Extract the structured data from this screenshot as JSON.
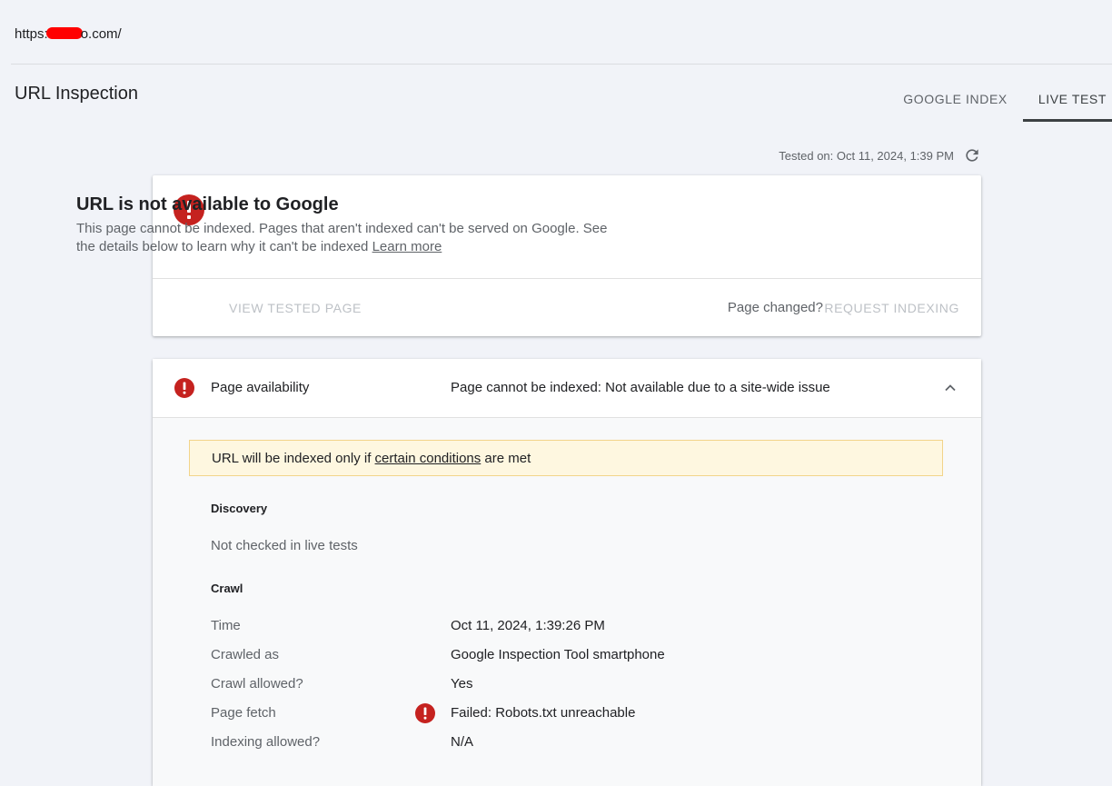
{
  "header": {
    "url_prefix": "https:",
    "url_suffix": "o.com/",
    "page_title": "URL Inspection",
    "tabs": [
      {
        "label": "GOOGLE INDEX",
        "active": false
      },
      {
        "label": "LIVE TEST",
        "active": true
      }
    ]
  },
  "test_info": {
    "tested_on": "Tested on: Oct 11, 2024, 1:39 PM"
  },
  "status_card": {
    "title": "URL is not available to Google",
    "description": "This page cannot be indexed. Pages that aren't indexed can't be served on Google. See the details below to learn why it can't be indexed",
    "learn_more": "Learn more",
    "view_tested_page": "VIEW TESTED PAGE",
    "page_changed": "Page changed?",
    "request_indexing": "REQUEST INDEXING"
  },
  "availability": {
    "label": "Page availability",
    "status": "Page cannot be indexed: Not available due to a site-wide issue",
    "notice_before": "URL will be indexed only if ",
    "notice_link": "certain conditions",
    "notice_after": " are met",
    "discovery": {
      "heading": "Discovery",
      "text": "Not checked in live tests"
    },
    "crawl": {
      "heading": "Crawl",
      "rows": [
        {
          "key": "Time",
          "value": "Oct 11, 2024, 1:39:26 PM",
          "error": false
        },
        {
          "key": "Crawled as",
          "value": "Google Inspection Tool smartphone",
          "error": false
        },
        {
          "key": "Crawl allowed?",
          "value": "Yes",
          "error": false
        },
        {
          "key": "Page fetch",
          "value": "Failed: Robots.txt unreachable",
          "error": true
        },
        {
          "key": "Indexing allowed?",
          "value": "N/A",
          "error": false
        }
      ]
    }
  },
  "colors": {
    "error": "#c5221f",
    "notice_bg": "#fef7e0",
    "notice_border": "#f2d48a"
  }
}
